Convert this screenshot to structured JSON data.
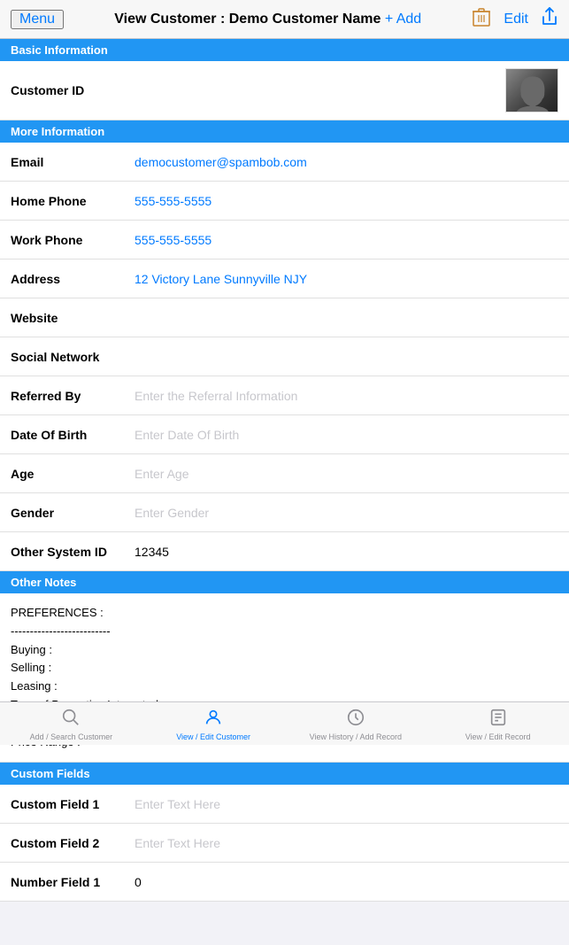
{
  "header": {
    "menu_label": "Menu",
    "title": "View Customer : Demo Customer Name",
    "add_label": "+ Add",
    "edit_label": "Edit"
  },
  "sections": {
    "basic_info": "Basic Information",
    "more_info": "More Information",
    "other_notes": "Other Notes",
    "custom_fields": "Custom Fields"
  },
  "basic": {
    "customer_id_label": "Customer ID"
  },
  "more": {
    "email_label": "Email",
    "email_value": "democustomer@spambob.com",
    "home_phone_label": "Home Phone",
    "home_phone_value": "555-555-5555",
    "work_phone_label": "Work Phone",
    "work_phone_value": "555-555-5555",
    "address_label": "Address",
    "address_value": "12 Victory Lane Sunnyville NJY",
    "website_label": "Website",
    "website_placeholder": "",
    "social_network_label": "Social Network",
    "social_network_placeholder": "",
    "referred_by_label": "Referred By",
    "referred_by_placeholder": "Enter the Referral Information",
    "dob_label": "Date Of Birth",
    "dob_placeholder": "Enter Date Of Birth",
    "age_label": "Age",
    "age_placeholder": "Enter Age",
    "gender_label": "Gender",
    "gender_placeholder": "Enter Gender",
    "other_system_id_label": "Other System ID",
    "other_system_id_value": "12345"
  },
  "notes": {
    "content": "PREFERENCES :\n--------------------------\nBuying :\nSelling :\nLeasing :\nType of Properties Interested :\nTarget Area :\nPrice Range :"
  },
  "custom": {
    "field1_label": "Custom Field 1",
    "field1_placeholder": "Enter Text Here",
    "field2_label": "Custom Field 2",
    "field2_placeholder": "Enter Text Here",
    "number_field1_label": "Number Field 1",
    "number_field1_value": "0"
  },
  "tabs": {
    "add_search": "Add / Search Customer",
    "view_edit": "View / Edit Customer",
    "view_history": "View History / Add Record",
    "view_edit_record": "View / Edit Record"
  }
}
